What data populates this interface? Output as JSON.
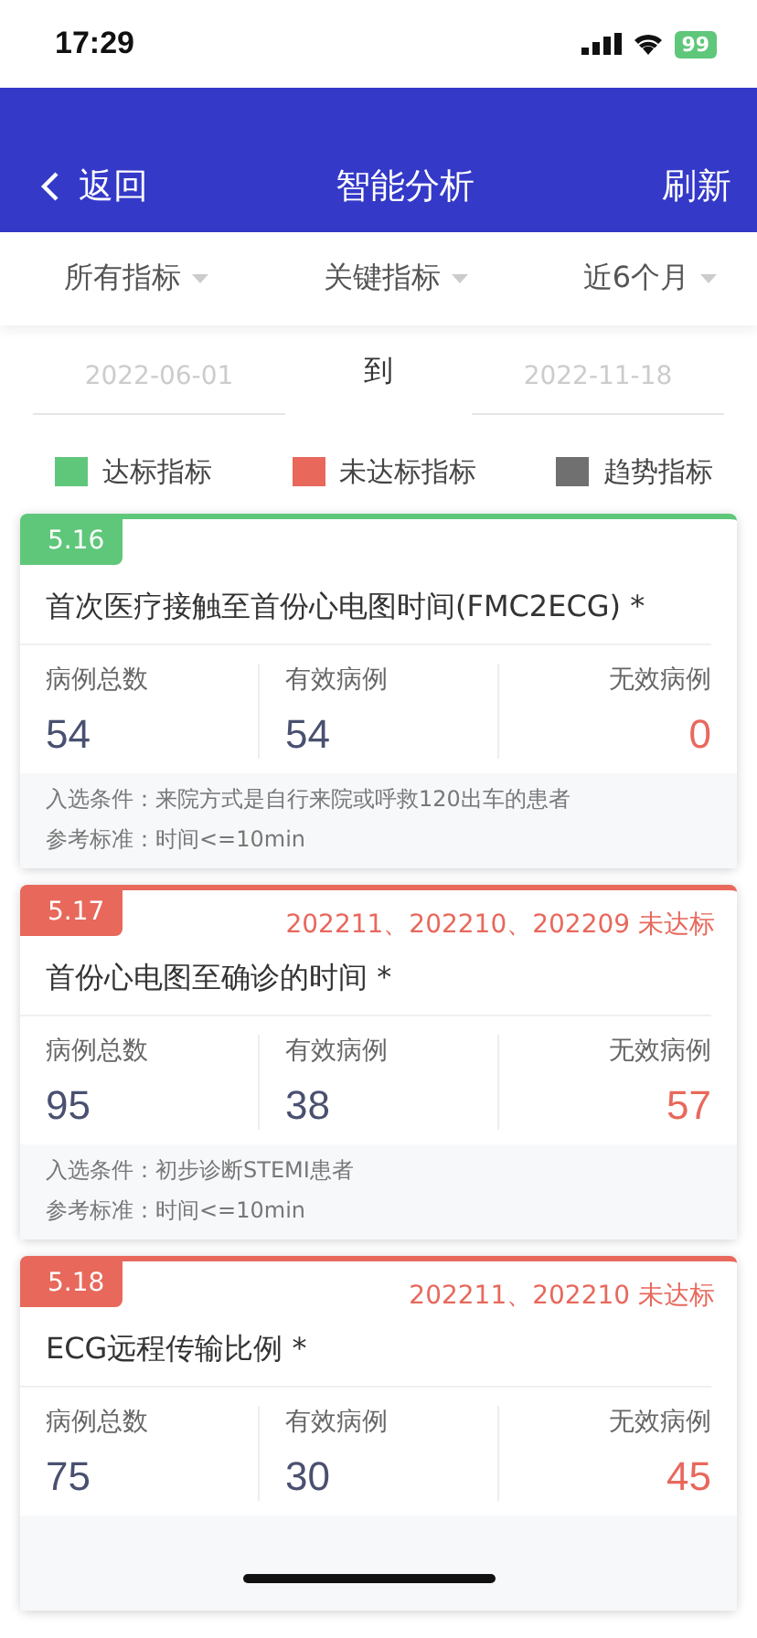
{
  "status_bar": {
    "time": "17:29",
    "battery": "99"
  },
  "header": {
    "back": "返回",
    "title": "智能分析",
    "action": "刷新"
  },
  "filters": [
    {
      "label": "所有指标"
    },
    {
      "label": "关键指标"
    },
    {
      "label": "近6个月"
    }
  ],
  "date_range": {
    "start": "2022-06-01",
    "separator": "到",
    "end": "2022-11-18"
  },
  "legend": [
    {
      "label": "达标指标",
      "color": "#5fc77a"
    },
    {
      "label": "未达标指标",
      "color": "#e8685c"
    },
    {
      "label": "趋势指标",
      "color": "#707070"
    }
  ],
  "cards": [
    {
      "number": "5.16",
      "color": "#5fc77a",
      "title": "首次医疗接触至首份心电图时间(FMC2ECG) *",
      "stats": [
        {
          "label": "病例总数",
          "value": "54",
          "kind": "normal"
        },
        {
          "label": "有效病例",
          "value": "54",
          "kind": "normal"
        },
        {
          "label": "无效病例",
          "value": "0",
          "kind": "invalid"
        }
      ],
      "notes": [
        "入选条件：来院方式是自行来院或呼救120出车的患者",
        "参考标准：时间<=10min"
      ]
    },
    {
      "number": "5.17",
      "color": "#e8685c",
      "status": "202211、202210、202209 未达标",
      "title": "首份心电图至确诊的时间 *",
      "stats": [
        {
          "label": "病例总数",
          "value": "95",
          "kind": "normal"
        },
        {
          "label": "有效病例",
          "value": "38",
          "kind": "normal"
        },
        {
          "label": "无效病例",
          "value": "57",
          "kind": "invalid"
        }
      ],
      "notes": [
        "入选条件：初步诊断STEMI患者",
        "参考标准：时间<=10min"
      ]
    },
    {
      "number": "5.18",
      "color": "#e8685c",
      "status": "202211、202210 未达标",
      "title": "ECG远程传输比例 *",
      "stats": [
        {
          "label": "病例总数",
          "value": "75",
          "kind": "normal"
        },
        {
          "label": "有效病例",
          "value": "30",
          "kind": "normal"
        },
        {
          "label": "无效病例",
          "value": "45",
          "kind": "invalid"
        }
      ]
    }
  ]
}
